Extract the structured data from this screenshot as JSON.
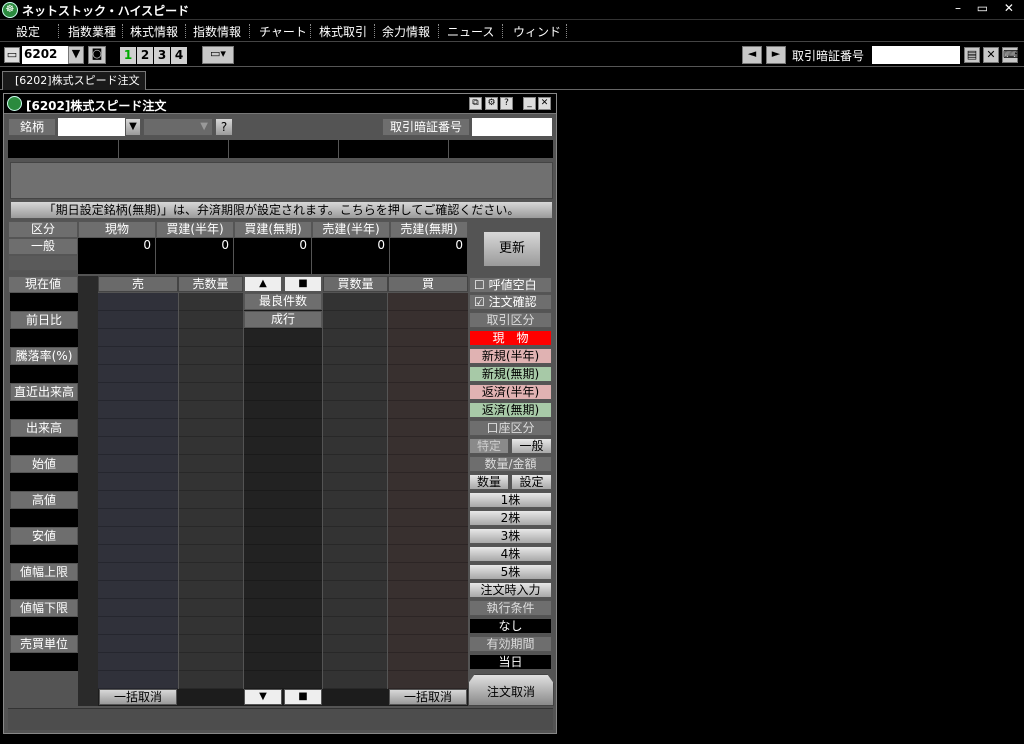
{
  "app": {
    "title": "ネットストック・ハイスピード",
    "window_controls": "– ▭ ✕"
  },
  "menu": [
    "設定",
    "指数業種",
    "株式情報",
    "指数情報",
    "チャート",
    "株式取引",
    "余力情報",
    "ニュース",
    "ウィンド"
  ],
  "toolbar": {
    "symbol_value": "6202",
    "nums": [
      "1",
      "2",
      "3",
      "4"
    ],
    "pin_label": "取引暗証番号"
  },
  "tab": {
    "label": "[6202]株式スピード注文"
  },
  "panel": {
    "title": "[6202]株式スピード注文",
    "meigara_label": "銘柄",
    "help": "?",
    "pin_label": "取引暗証番号",
    "notice": "「期日設定銘柄(無期)」は、弁済期限が設定されます。こちらを押してご確認ください。",
    "pos_headers": [
      "区分",
      "現物",
      "買建(半年)",
      "買建(無期)",
      "売建(半年)",
      "売建(無期)"
    ],
    "pos_row_label": "一般",
    "pos_values": [
      "0",
      "0",
      "0",
      "0",
      "0"
    ],
    "refresh": "更新",
    "board_headers": [
      "売",
      "売数量",
      "▲",
      "■",
      "買数量",
      "買"
    ],
    "mid_cells": [
      "最良件数",
      "成行"
    ],
    "left_labels": [
      "現在値",
      "前日比",
      "騰落率(%)",
      "直近出来高",
      "出来高",
      "始値",
      "高値",
      "安値",
      "値幅上限",
      "値幅下限",
      "売買単位"
    ],
    "right": {
      "yobine": "呼値空白",
      "kakunin": "注文確認",
      "torihiki": "取引区分",
      "genbutsu": "現　物",
      "shinki_han": "新規(半年)",
      "shinki_mu": "新規(無期)",
      "hensai_han": "返済(半年)",
      "hensai_mu": "返済(無期)",
      "koza": "口座区分",
      "tokutei": "特定",
      "ippan": "一般",
      "suryo_kingaku": "数量/金額",
      "suryo": "数量",
      "settei": "設定",
      "lots": [
        "1株",
        "2株",
        "3株",
        "4株",
        "5株"
      ],
      "jinyuryoku": "注文時入力",
      "shikko": "執行条件",
      "nashi": "なし",
      "yuko": "有効期間",
      "tojitsu": "当日",
      "torikeshi": "注文取消"
    },
    "bulk_cancel": "一括取消",
    "down_btns": [
      "▼",
      "■"
    ]
  },
  "colors": {
    "genbutsu": "#ff0000",
    "shinki": "#e6b0b0",
    "shinki_mu": "#a8c8a8"
  }
}
